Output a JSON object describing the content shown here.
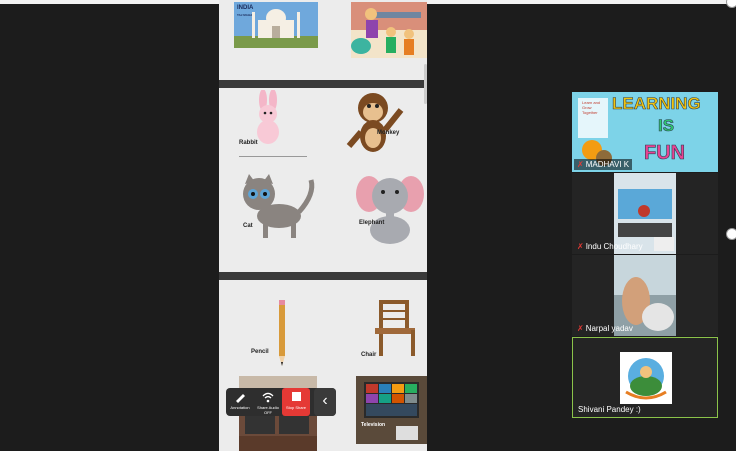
{
  "slides": {
    "top": {
      "left_caption": "INDIA",
      "left_subcaption": "TAJ MAHAL"
    },
    "animals": [
      {
        "label": "Rabbit"
      },
      {
        "label": "Monkey"
      },
      {
        "label": "Cat"
      },
      {
        "label": "Elephant"
      }
    ],
    "objects": [
      {
        "label": "Pencil"
      },
      {
        "label": "Chair"
      },
      {
        "label": "Television"
      }
    ]
  },
  "share_toolbar": {
    "annotation_label": "Annotation",
    "share_audio_label": "Share Audio OFF",
    "stop_share_label": "Stop Share"
  },
  "participants": [
    {
      "name": "MADHAVI K",
      "muted": true,
      "tile_text": [
        "LEARNING",
        "IS",
        "FUN"
      ],
      "tile_small_text": "Learn and Grow Together"
    },
    {
      "name": "Indu Choudhary",
      "muted": true
    },
    {
      "name": "Narpal yadav",
      "muted": true
    },
    {
      "name": "Shivani Pandey :)",
      "muted": false,
      "active_speaker": true
    }
  ],
  "colors": {
    "active_border": "#8bc34a",
    "stop_red": "#e53935",
    "muted_mic": "#e53935"
  }
}
